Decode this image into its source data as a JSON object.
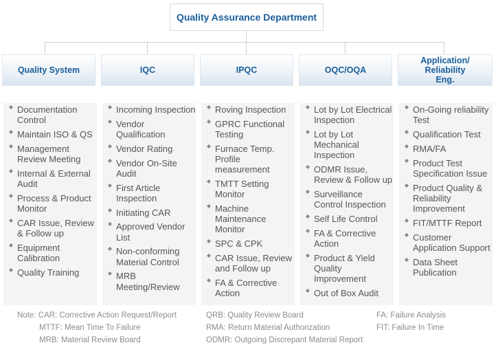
{
  "title": "Quality Assurance Department",
  "columns": [
    {
      "header": "Quality System",
      "items": [
        "Documentation Control",
        "Maintain ISO & QS",
        "Management Review Meeting",
        "Internal & External Audit",
        "Process & Product Monitor",
        "CAR Issue, Review & Follow up",
        "Equipment Calibration",
        "Quality Training"
      ]
    },
    {
      "header": "IQC",
      "items": [
        "Incoming Inspection",
        "Vendor Qualification",
        "Vendor Rating",
        "Vendor On-Site Audit",
        "First Article Inspection",
        "Initiating CAR",
        "Approved Vendor List",
        "Non-conforming Material Control",
        "MRB Meeting/Review"
      ]
    },
    {
      "header": "IPQC",
      "items": [
        "Roving Inspection",
        "GPRC Functional Testing",
        "Furnace Temp. Profile measurement",
        "TMTT Setting Monitor",
        "Machine Maintenance Monitor",
        "SPC & CPK",
        "CAR Issue, Review and Follow up",
        "FA & Corrective Action"
      ]
    },
    {
      "header": "OQC/OQA",
      "items": [
        "Lot by Lot Electrical Inspection",
        "Lot by Lot Mechanical Inspection",
        "ODMR Issue, Review & Follow up",
        "Surveillance Control Inspection",
        "Self Life Control",
        "FA & Corrective Action",
        "Product & Yield Quality Improvement",
        "Out of Box Audit"
      ]
    },
    {
      "header": "Application/ Reliability Eng.",
      "items": [
        "On-Going reliability Test",
        "Qualification Test",
        "RMA/FA",
        "Product Test Specification Issue",
        "Product Quality & Reliability Improvement",
        "FIT/MTTF Report",
        "Customer Application Support",
        "Data Sheet Publication"
      ]
    }
  ],
  "notes": {
    "note1": "Note: CAR: Corrective Action Request/Report",
    "note2": "MTTF: Mean Time To Failure",
    "note3": "MRB: Material Review Board",
    "note4": "QRB: Quality Review Board",
    "note5": "RMA: Return Material Authorization",
    "note6": "ODMR: Outgoing Discrepant Material Report",
    "note7": "FA: Failure Analysis",
    "note8": "FIT: Failure In Time"
  }
}
